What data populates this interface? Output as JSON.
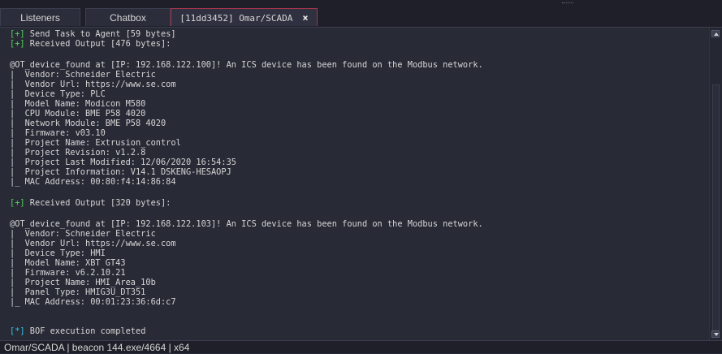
{
  "tabs": [
    {
      "label": "Listeners"
    },
    {
      "label": "Chatbox"
    },
    {
      "label": "[11dd3452] Omar/SCADA",
      "close_icon": "×"
    }
  ],
  "console": {
    "line1": {
      "tag": "[+]",
      "text": " Send Task to Agent [59 bytes]"
    },
    "line2": {
      "tag": "[+]",
      "text": " Received Output [476 bytes]:"
    },
    "block1": [
      "@OT_device_found at [IP: 192.168.122.100]! An ICS device has been found on the Modbus network.",
      "|  Vendor: Schneider Electric",
      "|  Vendor Url: https://www.se.com",
      "|  Device Type: PLC",
      "|  Model Name: Modicon M580",
      "|  CPU Module: BME P58 4020",
      "|  Network Module: BME P58 4020",
      "|  Firmware: v03.10",
      "|  Project Name: Extrusion_control",
      "|  Project Revision: v1.2.8",
      "|  Project Last Modified: 12/06/2020 16:54:35",
      "|  Project Information: V14.1 DSKENG-HESAOPJ",
      "|_ MAC Address: 00:80:f4:14:86:84"
    ],
    "line3": {
      "tag": "[+]",
      "text": " Received Output [320 bytes]:"
    },
    "block2": [
      "@OT_device_found at [IP: 192.168.122.103]! An ICS device has been found on the Modbus network.",
      "|  Vendor: Schneider Electric",
      "|  Vendor Url: https://www.se.com",
      "|  Device Type: HMI",
      "|  Model Name: XBT GT43",
      "|  Firmware: v6.2.10.21",
      "|  Project Name: HMI_Area_10b",
      "|  Panel Type: HMIG3U_DT351",
      "|_ MAC Address: 00:01:23:36:6d:c7"
    ],
    "line4": {
      "tag": "[*]",
      "text": " BOF execution completed"
    }
  },
  "status_bar": {
    "text": "Omar/SCADA | beacon 144.exe/4664 | x64"
  },
  "colors": {
    "background": "#282a36",
    "accent_tab_border": "#a8354a",
    "tag_green": "#50d65a",
    "tag_cyan": "#34c5e8"
  }
}
